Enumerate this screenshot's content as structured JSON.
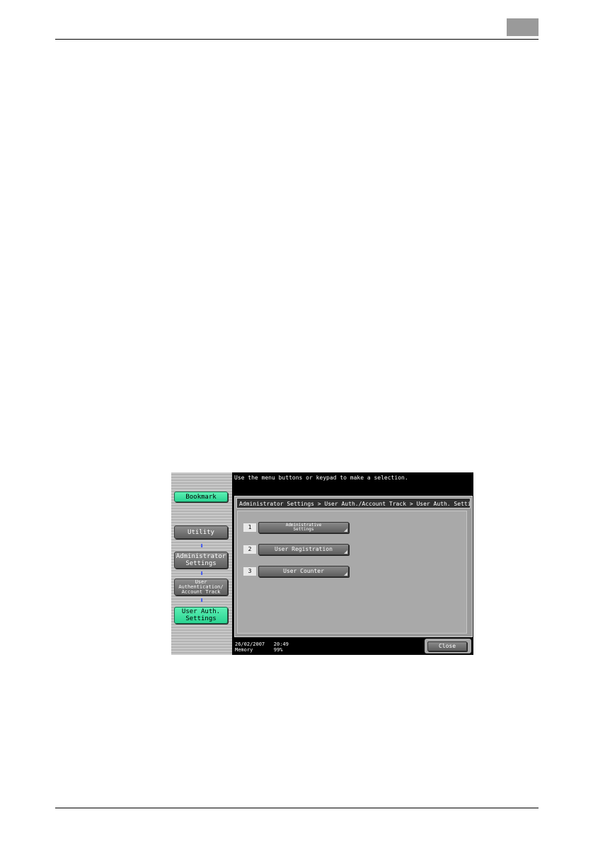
{
  "screen": {
    "message": "Use the menu buttons or keypad to make a selection.",
    "breadcrumb": "Administrator Settings > User Auth./Account Track > User Auth. Settings",
    "sidebar": {
      "bookmark": "Bookmark",
      "items": [
        {
          "label": "Utility"
        },
        {
          "label": "Administrator\nSettings"
        },
        {
          "label": "User\nAuthentication/\nAccount Track"
        },
        {
          "label": "User Auth.\nSettings"
        }
      ]
    },
    "menu": [
      {
        "number": "1",
        "label": "Administrative\nSettings"
      },
      {
        "number": "2",
        "label": "User Registration"
      },
      {
        "number": "3",
        "label": "User Counter"
      }
    ],
    "status": {
      "datetime": "26/02/2007   20:49",
      "memory": "Memory       99%"
    },
    "close_label": "Close"
  },
  "colors": {
    "highlight_green": "#2bd392",
    "arrow_blue": "#1f3cff",
    "page_tab_gray": "#9a9a9a"
  }
}
